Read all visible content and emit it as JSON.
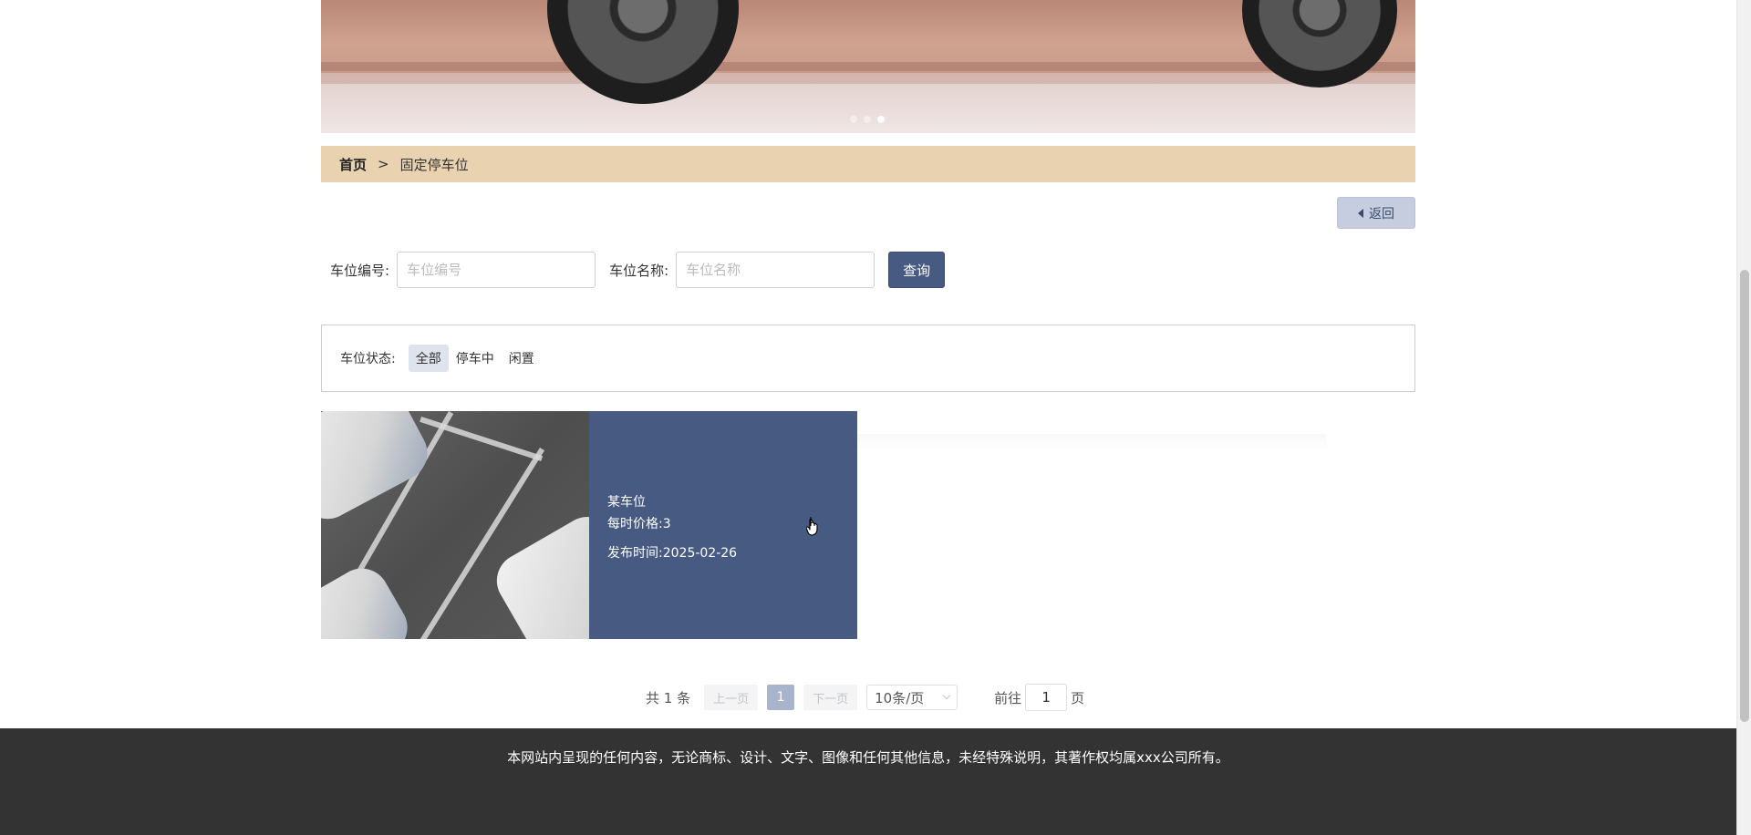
{
  "banner": {
    "dots": [
      false,
      false,
      true
    ]
  },
  "breadcrumb": {
    "home": "首页",
    "separator": ">",
    "current": "固定停车位"
  },
  "back_button": {
    "label": "返回"
  },
  "search": {
    "number_label": "车位编号:",
    "number_placeholder": "车位编号",
    "number_value": "",
    "name_label": "车位名称:",
    "name_placeholder": "车位名称",
    "name_value": "",
    "query_label": "查询"
  },
  "filter": {
    "label": "车位状态:",
    "options": [
      "全部",
      "停车中",
      "闲置"
    ],
    "selected": "全部"
  },
  "cards": [
    {
      "title": "某车位",
      "price": "每时价格:3",
      "time_label": "发布时间:",
      "time_value": "2025-02-26"
    }
  ],
  "pagination": {
    "total": "共 1 条",
    "prev": "上一页",
    "current_page": "1",
    "next": "下一页",
    "page_size": "10条/页",
    "goto_prefix": "前往",
    "goto_value": "1",
    "goto_suffix": "页"
  },
  "footer": {
    "text": "本网站内呈现的任何内容，无论商标、设计、文字、图像和任何其他信息，未经特殊说明，其著作权均属xxx公司所有。"
  },
  "colors": {
    "accent": "#475a82",
    "breadcrumb_bg": "#e8d2b0",
    "footer_bg": "#333333"
  }
}
